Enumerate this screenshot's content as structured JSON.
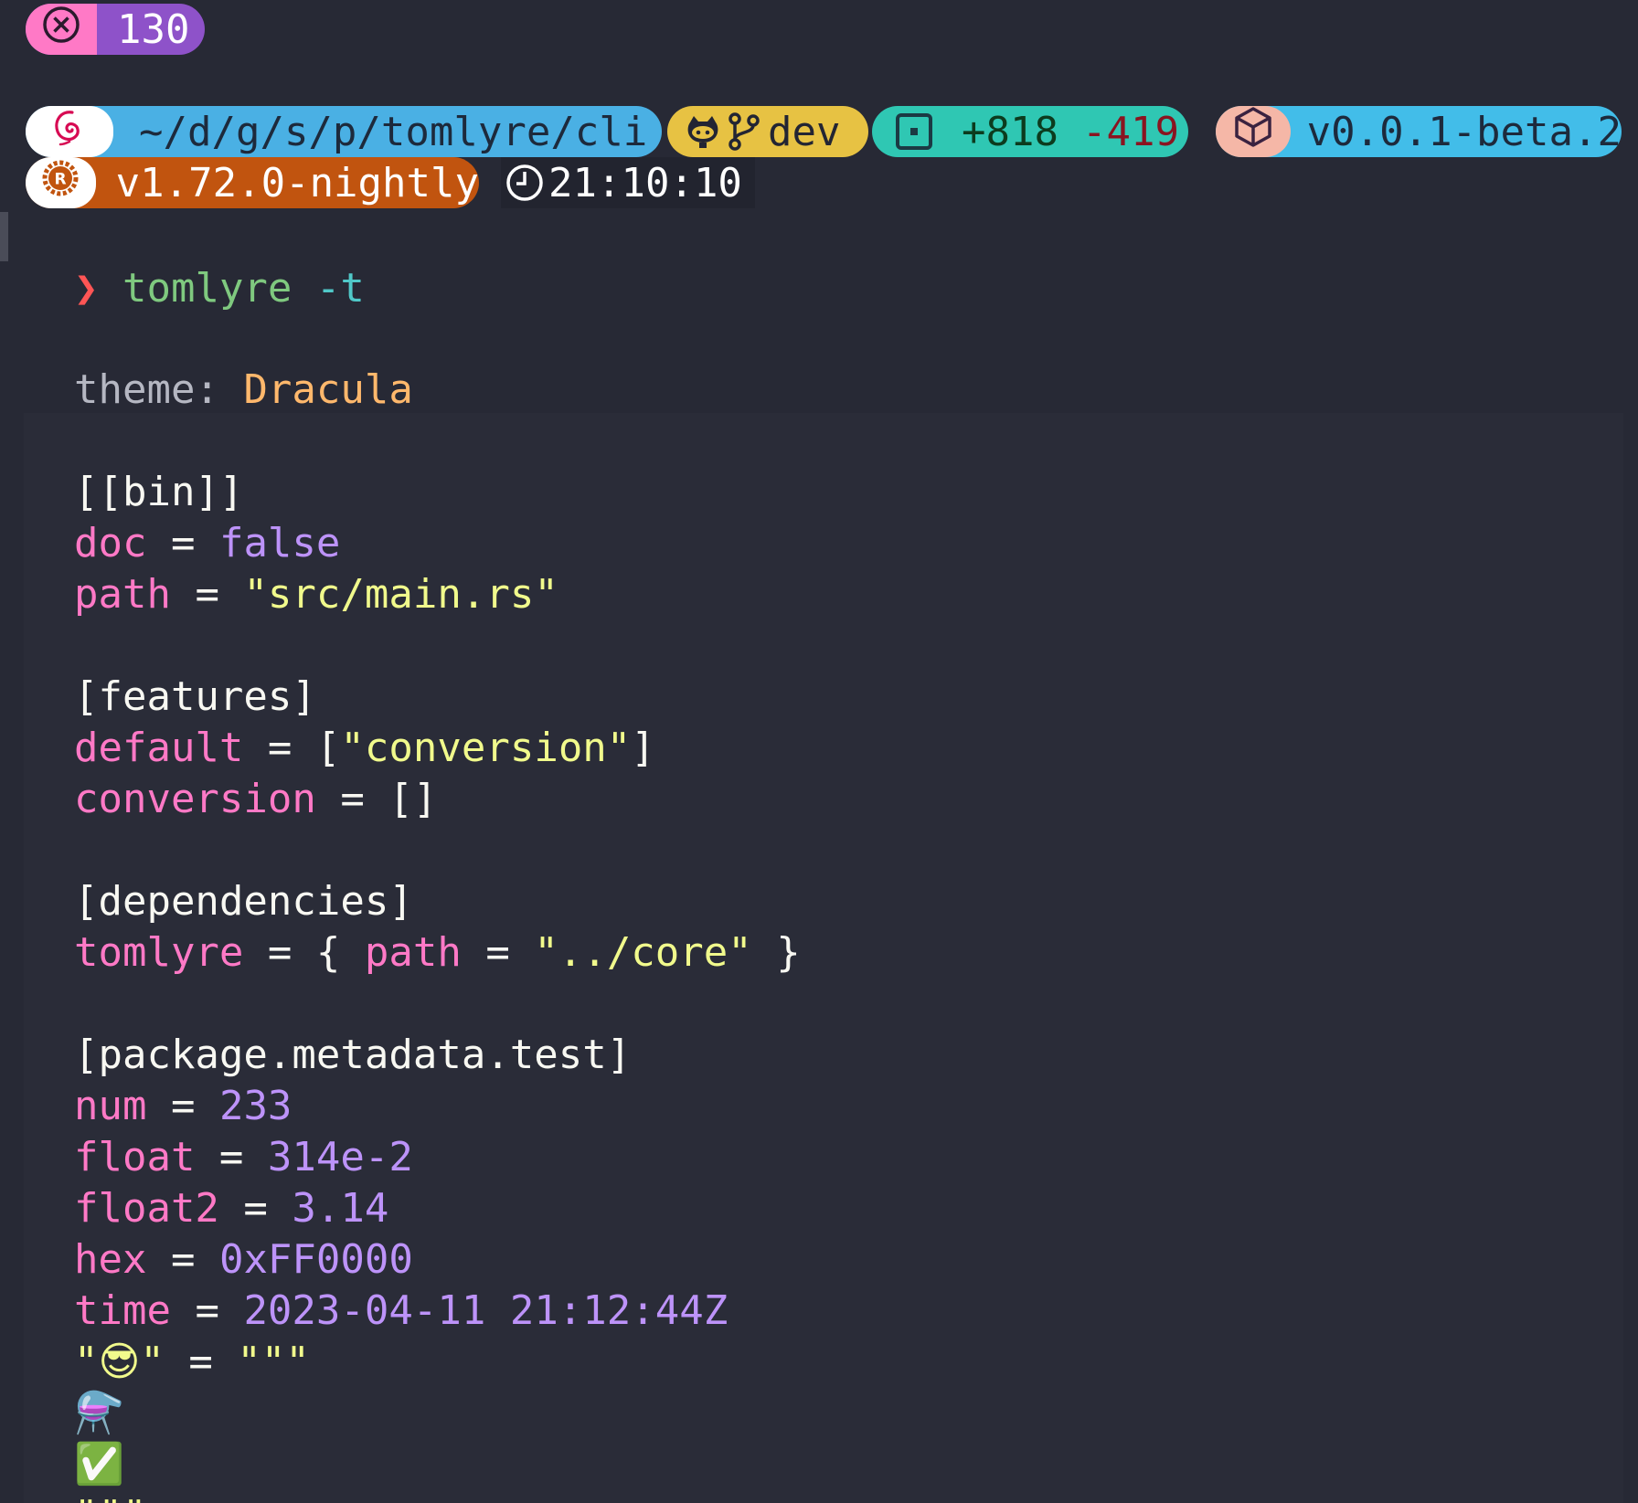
{
  "exit_status": {
    "code": "130",
    "icon": "close-circle-icon",
    "colors": {
      "icon_bg": "#ff79c6",
      "code_bg": "#8e52c9"
    }
  },
  "prompt": {
    "path": "~/d/g/s/p/tomlyre/cli",
    "os_icon": "debian-icon",
    "branch_icons": [
      "github-icon",
      "git-branch-icon"
    ],
    "branch": "dev",
    "diff_icon": "diff-box-icon",
    "added": "+818",
    "removed": "-419",
    "package_icon": "package-box-icon",
    "version": "v0.0.1-beta.2",
    "rust_icon": "rust-icon",
    "rust_version": "v1.72.0-nightly",
    "clock_icon": "clock-icon",
    "time": "21:10:10",
    "chevron": "❯",
    "command": "tomlyre",
    "flag": "-t",
    "colors": {
      "path_bg": "#4ab0e4",
      "branch_bg": "#e7c243",
      "diff_bg": "#2fc7b3",
      "version_bg": "#42bde9",
      "pkg_icon_bg": "#f5b7a7",
      "rust_bg": "#c1540f",
      "chevron": "#ff5555",
      "command": "#7fc97f",
      "flag": "#50c8c8"
    }
  },
  "theme_line": {
    "label": "theme:",
    "value": "Dracula"
  },
  "toml": {
    "bin_header": "[[bin]]",
    "doc_key": "doc",
    "doc_val": "false",
    "path_key": "path",
    "path_val": "\"src/main.rs\"",
    "features_header": "[features]",
    "default_key": "default",
    "default_open": "[",
    "default_val": "\"conversion\"",
    "default_close": "]",
    "conversion_key": "conversion",
    "conversion_val": "[]",
    "deps_header": "[dependencies]",
    "tomlyre_key": "tomlyre",
    "tomlyre_open": "{ ",
    "tomlyre_inner_key": "path",
    "tomlyre_inner_val": "\"../core\"",
    "tomlyre_close": " }",
    "meta_header": "[package.metadata.test]",
    "num_key": "num",
    "num_val": "233",
    "float_key": "float",
    "float_val": "314e-2",
    "float2_key": "float2",
    "float2_val": "3.14",
    "hex_key": "hex",
    "hex_val": "0xFF0000",
    "time_key": "time",
    "time_val": "2023-04-11 21:12:44Z",
    "emoji_key_q1": "\"",
    "emoji_key": "😎",
    "emoji_key_q2": "\"",
    "triple_open": "\"\"\"",
    "emoji_line1": "⚗️",
    "emoji_line2": "✅",
    "triple_close": "\"\"\"",
    "eq": " = "
  }
}
